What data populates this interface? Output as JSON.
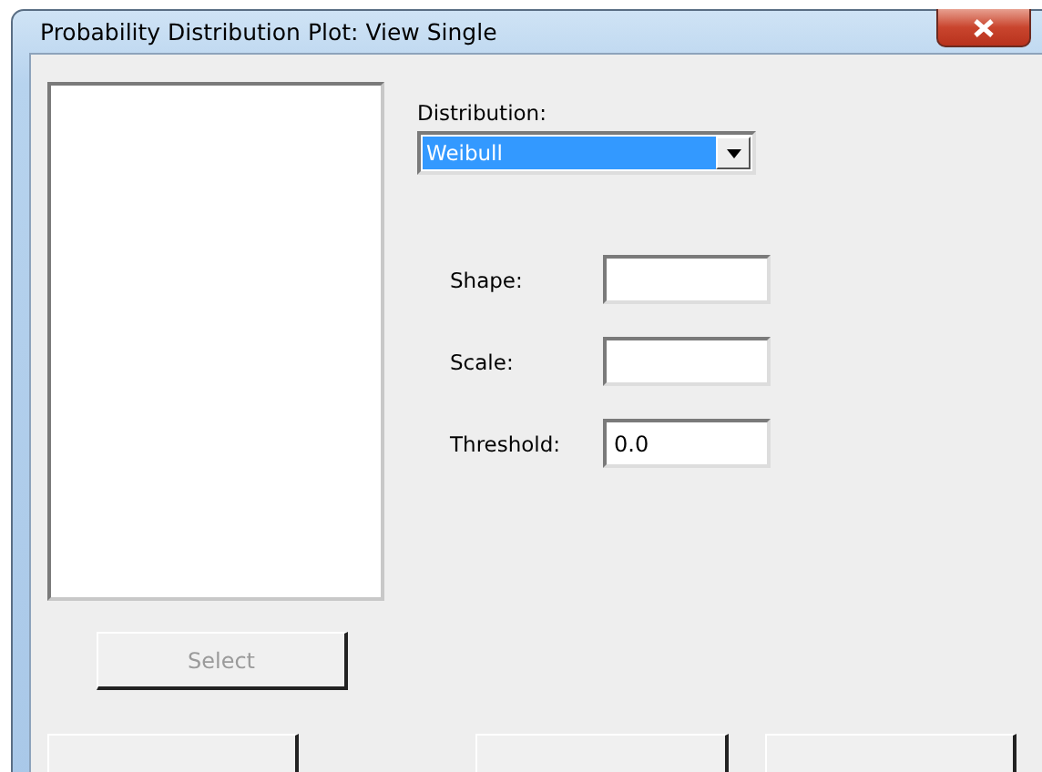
{
  "window": {
    "title": "Probability Distribution Plot: View Single"
  },
  "select_button": {
    "label": "Select",
    "disabled": true
  },
  "distribution": {
    "label": "Distribution:",
    "value": "Weibull",
    "selected": true
  },
  "parameters": [
    {
      "label": "Shape:"
    },
    {
      "label": "Scale:"
    },
    {
      "label": "Threshold:",
      "value": "0.0"
    }
  ],
  "bottom_buttons": [
    {
      "disabled": false
    },
    {
      "disabled": false
    },
    {
      "disabled": false
    }
  ]
}
